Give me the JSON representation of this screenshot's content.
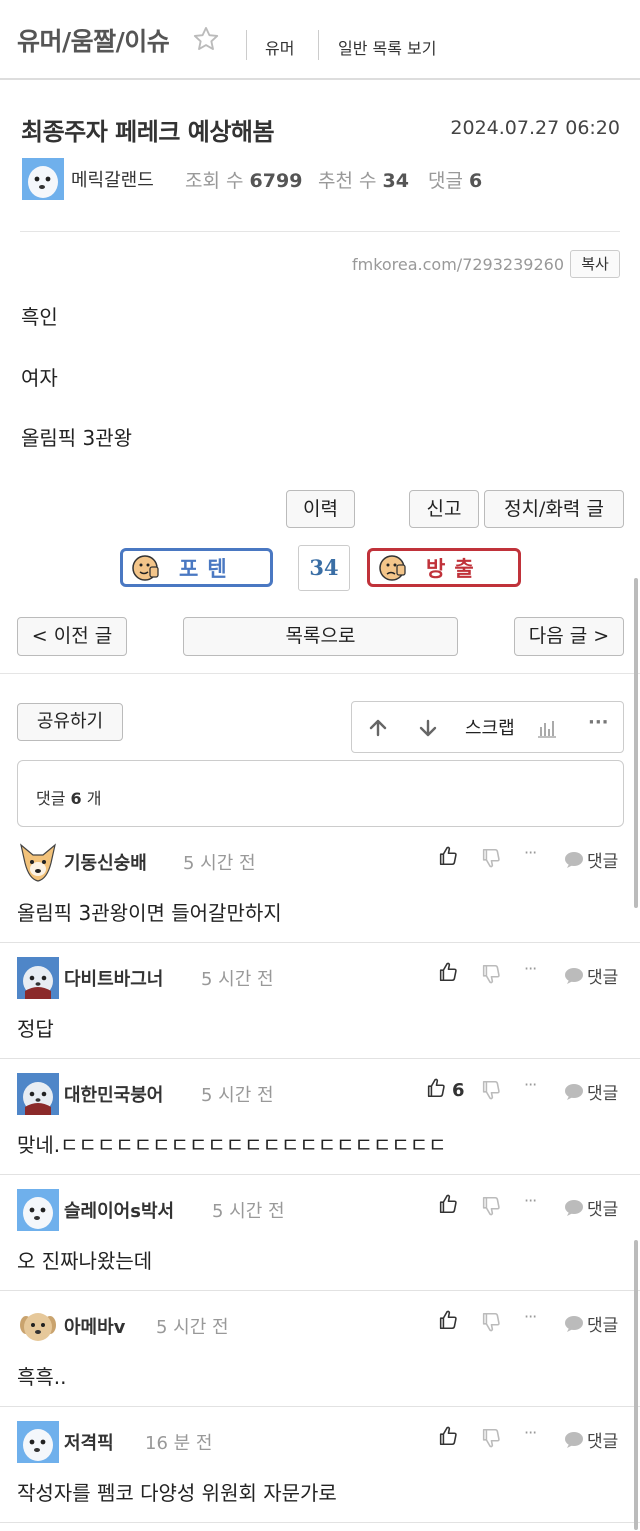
{
  "header": {
    "board_title": "유머/움짤/이슈",
    "nav_humor": "유머",
    "nav_list": "일반 목록 보기"
  },
  "post": {
    "title": "최종주자 페레크 예상해봄",
    "date": "2024.07.27 06:20",
    "author": "메릭갈랜드",
    "views_label": "조회 수",
    "views": "6799",
    "recommend_label": "추천 수",
    "recommend": "34",
    "comments_label": "댓글",
    "comments": "6",
    "url": "fmkorea.com/7293239260",
    "copy_label": "복사",
    "body": [
      "흑인",
      "여자",
      "올림픽 3관왕"
    ]
  },
  "actions": {
    "history": "이력",
    "report": "신고",
    "politics": "정치/화력 글",
    "upvote": "포텐",
    "vote_count": "34",
    "downvote": "방출",
    "prev": "< 이전 글",
    "list": "목록으로",
    "next": "다음 글 >",
    "share": "공유하기",
    "scrap": "스크랩",
    "more": "···"
  },
  "comments_header": {
    "label": "댓글",
    "count": "6",
    "unit": "개"
  },
  "comments": [
    {
      "name": "기동신숭배",
      "time": "5 시간 전",
      "text": "올림픽 3관왕이면 들어갈만하지",
      "likes": "",
      "reply": "댓글",
      "avatar": "dog"
    },
    {
      "name": "다비트바그너",
      "time": "5 시간 전",
      "text": "정답",
      "likes": "",
      "reply": "댓글",
      "avatar": "bird-dark"
    },
    {
      "name": "대한민국붕어",
      "time": "5 시간 전",
      "text": "맞네.ㄷㄷㄷㄷㄷㄷㄷㄷㄷㄷㄷㄷㄷㄷㄷㄷㄷㄷㄷㄷㄷ",
      "likes": "6",
      "reply": "댓글",
      "avatar": "bird-dark"
    },
    {
      "name": "슬레이어s박서",
      "time": "5 시간 전",
      "text": "오 진짜나왔는데",
      "likes": "",
      "reply": "댓글",
      "avatar": "bird-blue"
    },
    {
      "name": "아메바v",
      "time": "5 시간 전",
      "text": "흑흑..",
      "likes": "",
      "reply": "댓글",
      "avatar": "puppy"
    },
    {
      "name": "저격픽",
      "time": "16 분 전",
      "text": "작성자를 펨코 다양성 위원회 자문가로",
      "likes": "",
      "reply": "댓글",
      "avatar": "bird-blue"
    }
  ],
  "colors": {
    "upvote": "#4a78c2",
    "downvote": "#c0323a",
    "vote_count": "#3a6ea5"
  }
}
